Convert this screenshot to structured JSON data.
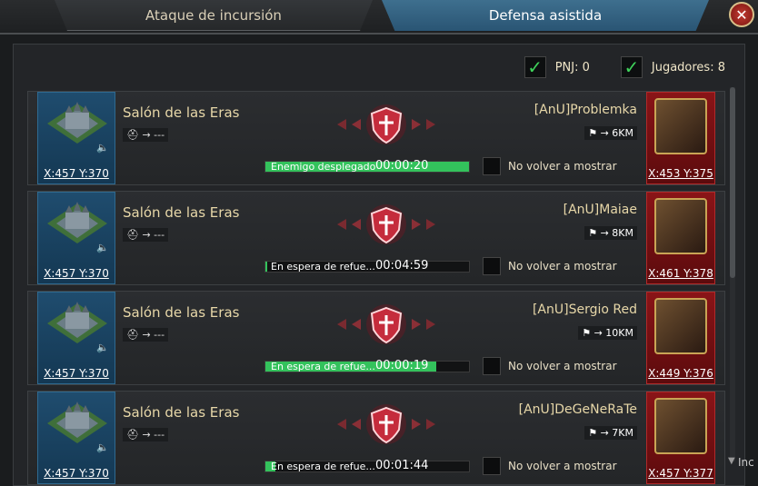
{
  "tabs": [
    {
      "label": "Ataque de incursión",
      "active": false
    },
    {
      "label": "Defensa asistida",
      "active": true
    }
  ],
  "close_icon": "close-icon",
  "filters": {
    "pnj_label": "PNJ: 0",
    "players_label": "Jugadores: 8"
  },
  "rows": [
    {
      "target_name": "Salón de las Eras",
      "target_coords": "X:457 Y:370",
      "target_info": "→ ---",
      "player_name": "[AnU]Problemka",
      "player_distance": "→ 6KM",
      "player_coords": "X:453 Y:375",
      "status_text": "Enemigo desplegado",
      "status_time": "00:00:20",
      "progress": 1.0,
      "dont_show": "No volver a mostrar"
    },
    {
      "target_name": "Salón de las Eras",
      "target_coords": "X:457 Y:370",
      "target_info": "→ ---",
      "player_name": "[AnU]Maiae",
      "player_distance": "→ 8KM",
      "player_coords": "X:461 Y:378",
      "status_text": "En espera de refue...",
      "status_time": "00:04:59",
      "progress": 0.01,
      "dont_show": "No volver a mostrar"
    },
    {
      "target_name": "Salón de las Eras",
      "target_coords": "X:457 Y:370",
      "target_info": "→ ---",
      "player_name": "[AnU]Sergio Red",
      "player_distance": "→ 10KM",
      "player_coords": "X:449 Y:376",
      "status_text": "En espera de refue...",
      "status_time": "00:00:19",
      "progress": 0.84,
      "dont_show": "No volver a mostrar"
    },
    {
      "target_name": "Salón de las Eras",
      "target_coords": "X:457 Y:370",
      "target_info": "→ ---",
      "player_name": "[AnU]DeGeNeRaTe",
      "player_distance": "→ 7KM",
      "player_coords": "X:457 Y:377",
      "status_text": "En espera de refue...",
      "status_time": "00:01:44",
      "progress": 0.05,
      "dont_show": "No volver a mostrar"
    }
  ],
  "side_label": "Inc"
}
